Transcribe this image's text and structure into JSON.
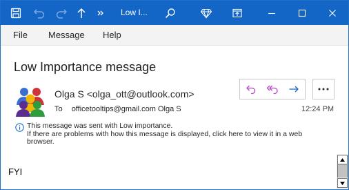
{
  "titlebar": {
    "title": "Low I...",
    "icons": {
      "save": "save-icon",
      "undo": "undo-icon",
      "redo": "redo-icon",
      "up": "arrow-up-icon",
      "more": "chevron-double-right-icon",
      "search": "search-icon",
      "gem": "diamond-icon",
      "restore": "restore-window-icon",
      "minimize": "minimize-icon",
      "maximize": "maximize-icon",
      "close": "close-icon"
    },
    "color": "#1466c6"
  },
  "menu": {
    "items": [
      "File",
      "Message",
      "Help"
    ]
  },
  "message": {
    "subject": "Low Importance message",
    "from": "Olga S <olga_ott@outlook.com>",
    "to_label": "To",
    "to": "officetooltips@gmail.com Olga S",
    "time": "12:24 PM",
    "info_line1": "This message was sent with Low importance.",
    "info_line2": "If there are problems with how this message is displayed, click here to view it in a web browser.",
    "body": "FYI"
  },
  "actions": {
    "reply": "reply-icon",
    "reply_all": "reply-all-icon",
    "forward": "forward-icon",
    "more": "more-options-icon",
    "accent": "#b146c2",
    "forward_color": "#1466c6"
  }
}
